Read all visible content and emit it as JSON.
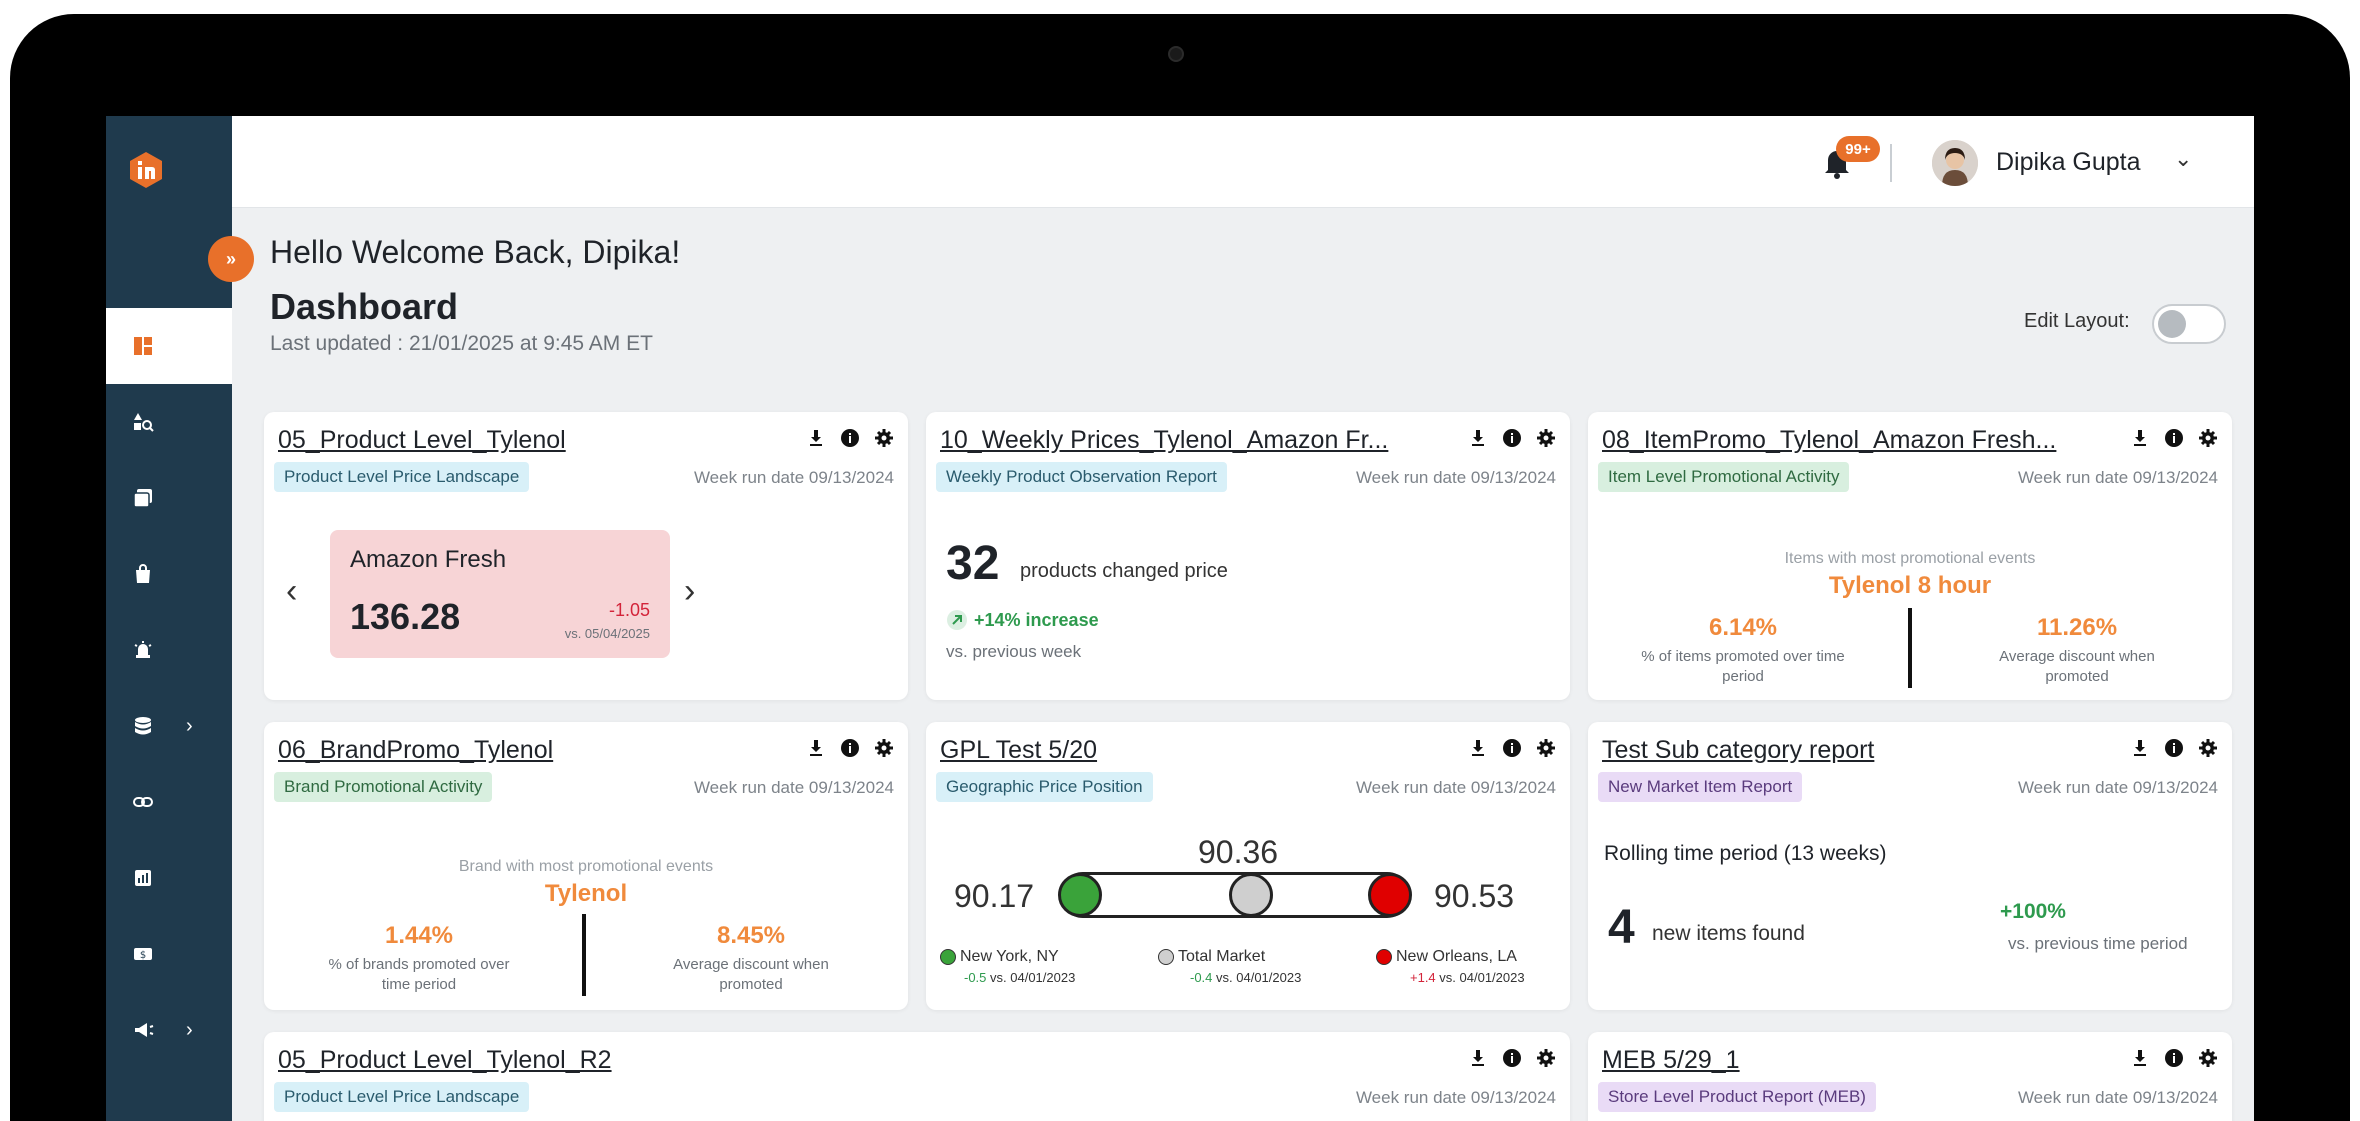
{
  "user": {
    "name": "Dipika Gupta",
    "notifications": "99+"
  },
  "header": {
    "welcome": "Hello Welcome Back, Dipika!",
    "title": "Dashboard",
    "last_updated": "Last updated : 21/01/2025 at 9:45 AM ET",
    "edit_layout_label": "Edit Layout:",
    "edit_layout_on": false
  },
  "colors": {
    "sidebar": "#1f3a4d",
    "accent": "#e8702a",
    "positive": "#2e9a4e",
    "negative": "#d3243a"
  },
  "cards": {
    "c1": {
      "title": "05_Product Level_Tylenol",
      "tag": "Product Level Price Landscape",
      "rundate": "Week run date 09/13/2024",
      "retailer": "Amazon Fresh",
      "value": "136.28",
      "delta": "-1.05",
      "vs": "vs. 05/04/2025"
    },
    "c2": {
      "title": "10_Weekly Prices_Tylenol_Amazon Fr...",
      "tag": "Weekly Product Observation Report",
      "rundate": "Week run date 09/13/2024",
      "count": "32",
      "count_label": "products changed price",
      "increase": "+14% increase",
      "vs": "vs. previous week"
    },
    "c3": {
      "title": "08_ItemPromo_Tylenol_Amazon Fresh...",
      "tag": "Item Level Promotional Activity",
      "rundate": "Week run date 09/13/2024",
      "subtitle": "Items with most promotional events",
      "top_item": "Tylenol 8 hour",
      "left_value": "6.14%",
      "left_label_1": "% of items promoted over time",
      "left_label_2": "period",
      "right_value": "11.26%",
      "right_label_1": "Average discount when",
      "right_label_2": "promoted"
    },
    "c4": {
      "title": "06_BrandPromo_Tylenol",
      "tag": "Brand Promotional Activity",
      "rundate": "Week run date 09/13/2024",
      "subtitle": "Brand with most promotional events",
      "top_item": "Tylenol",
      "left_value": "1.44%",
      "left_label_1": "% of brands promoted over",
      "left_label_2": "time period",
      "right_value": "8.45%",
      "right_label_1": "Average discount when",
      "right_label_2": "promoted"
    },
    "c5": {
      "title": "GPL Test 5/20",
      "tag": "Geographic Price Position",
      "rundate": "Week run date 09/13/2024",
      "left_value": "90.17",
      "mid_value": "90.36",
      "right_value": "90.53",
      "legend": [
        {
          "name": "New York, NY",
          "delta": "-0.5",
          "vs": "vs. 04/01/2023",
          "color": "#3aa33a"
        },
        {
          "name": "Total Market",
          "delta": "-0.4",
          "vs": "vs. 04/01/2023",
          "color": "#cfcfcf"
        },
        {
          "name": "New Orleans, LA",
          "delta": "+1.4",
          "vs": "vs. 04/01/2023",
          "color": "#e00000"
        }
      ]
    },
    "c6": {
      "title": "Test Sub category report",
      "tag": "New Market Item Report",
      "rundate": "Week run date 09/13/2024",
      "period": "Rolling time period (13 weeks)",
      "count": "4",
      "count_label": "new items found",
      "change": "+100%",
      "vs": "vs. previous time period"
    },
    "c7": {
      "title": "05_Product Level_Tylenol_R2",
      "tag": "Product Level Price Landscape",
      "rundate": "Week run date 09/13/2024"
    },
    "c8": {
      "title": "MEB 5/29_1",
      "tag": "Store Level Product Report (MEB)",
      "rundate": "Week run date 09/13/2024"
    }
  }
}
